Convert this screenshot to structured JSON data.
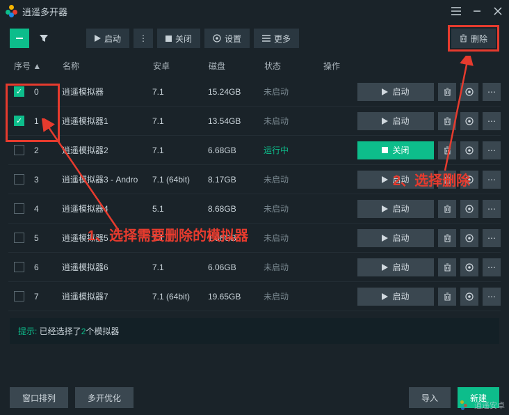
{
  "title": "逍遥多开器",
  "toolbar": {
    "start": "启动",
    "close": "关闭",
    "settings": "设置",
    "more": "更多",
    "delete": "删除"
  },
  "columns": {
    "seq": "序号",
    "name": "名称",
    "android": "安卓",
    "disk": "磁盘",
    "status": "状态",
    "ops": "操作"
  },
  "status_labels": {
    "not_started": "未启动",
    "running": "运行中"
  },
  "op_labels": {
    "start": "启动",
    "close": "关闭"
  },
  "rows": [
    {
      "checked": true,
      "seq": "0",
      "name": "逍遥模拟器",
      "android": "7.1",
      "disk": "15.24GB",
      "status": "not_started"
    },
    {
      "checked": true,
      "seq": "1",
      "name": "逍遥模拟器1",
      "android": "7.1",
      "disk": "13.54GB",
      "status": "not_started"
    },
    {
      "checked": false,
      "seq": "2",
      "name": "逍遥模拟器2",
      "android": "7.1",
      "disk": "6.68GB",
      "status": "running"
    },
    {
      "checked": false,
      "seq": "3",
      "name": "逍遥模拟器3 - Andro",
      "android": "7.1 (64bit)",
      "disk": "8.17GB",
      "status": "not_started"
    },
    {
      "checked": false,
      "seq": "4",
      "name": "逍遥模拟器4",
      "android": "5.1",
      "disk": "8.68GB",
      "status": "not_started"
    },
    {
      "checked": false,
      "seq": "5",
      "name": "逍遥模拟器5",
      "android": "7.1",
      "disk": "1.38GB",
      "status": "not_started"
    },
    {
      "checked": false,
      "seq": "6",
      "name": "逍遥模拟器6",
      "android": "7.1",
      "disk": "6.06GB",
      "status": "not_started"
    },
    {
      "checked": false,
      "seq": "7",
      "name": "逍遥模拟器7",
      "android": "7.1 (64bit)",
      "disk": "19.65GB",
      "status": "not_started"
    }
  ],
  "hint": {
    "label": "提示: ",
    "prefix": "已经选择了",
    "count": "2",
    "suffix": "个模拟器"
  },
  "footer": {
    "window_arrange": "窗口排列",
    "multi_optimize": "多开优化",
    "import": "导入",
    "new": "新建"
  },
  "annotations": {
    "a1": "1、选择需要删除的模拟器",
    "a2": "2、选择删除"
  },
  "watermark": "逍遥安卓"
}
